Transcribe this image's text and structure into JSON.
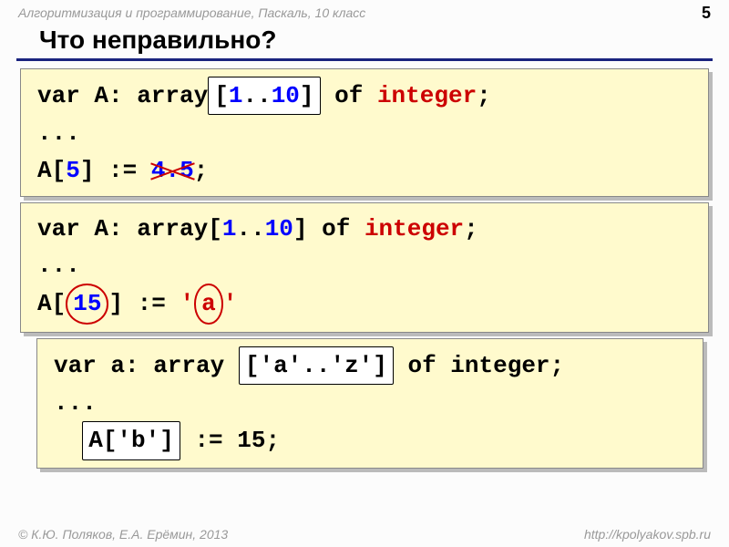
{
  "header": {
    "subject": "Алгоритмизация и программирование, Паскаль, 10 класс",
    "page_number": "5"
  },
  "title": "Что неправильно?",
  "code1": {
    "var": "var",
    "A": "A: array",
    "br_open": "[",
    "r1": "1",
    "dd": "..",
    "r10": "10",
    "br_close": "]",
    "of": "of",
    "integer": "integer",
    "semi": ";",
    "dots": "...",
    "line2a": "A[",
    "idx": "5",
    "line2b": "] :=",
    "bad": "4.5",
    "end": ";"
  },
  "code2": {
    "var": "var",
    "A": "A: array[",
    "r1": "1",
    "dd": "..",
    "r10": "10",
    "close": "] of",
    "integer": "integer",
    "semi": ";",
    "dots": "...",
    "line2a": "A[",
    "idx": "15",
    "line2b": "] :=",
    "q1": "'",
    "bad": "a",
    "q2": "'"
  },
  "code3": {
    "var": "var",
    "A": "a: array",
    "range": "['a'..'z']",
    "of": "of integer;",
    "dots": "...",
    "access": "A['b']",
    "assign": ":= 15;"
  },
  "footer": {
    "copyright": "© К.Ю. Поляков, Е.А. Ерёмин, 2013",
    "url": "http://kpolyakov.spb.ru"
  }
}
